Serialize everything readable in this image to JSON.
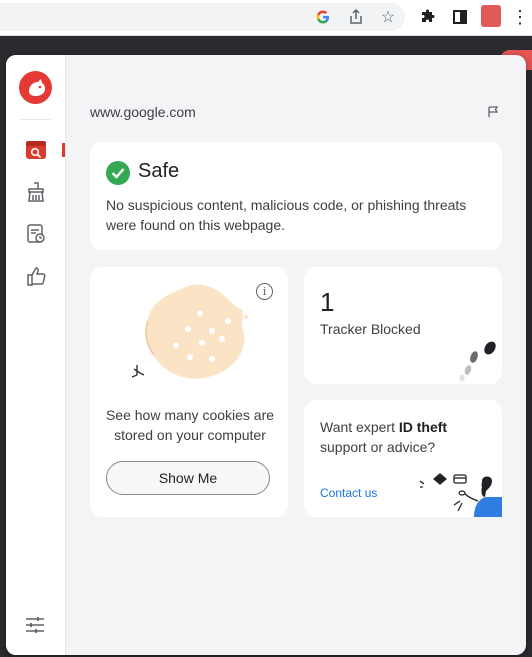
{
  "popup": {
    "domain": "www.google.com",
    "safe": {
      "title": "Safe",
      "description": "No suspicious content, malicious code, or phishing threats were found on this webpage."
    },
    "cookies": {
      "text": "See how many cookies are stored on your computer",
      "button_label": "Show Me"
    },
    "trackers": {
      "count": "1",
      "label": "Tracker Blocked"
    },
    "id_theft": {
      "text_prefix": "Want expert ",
      "text_bold": "ID theft",
      "text_suffix": " support or advice?",
      "link_label": "Contact us"
    }
  },
  "sidebar": {
    "items": [
      "web-scan",
      "cleaner",
      "browsing-history",
      "feedback"
    ]
  },
  "colors": {
    "brand_red": "#e53935",
    "safe_green": "#34a853",
    "link_blue": "#1a73e8",
    "cookie_peach": "#fbe3c6"
  }
}
